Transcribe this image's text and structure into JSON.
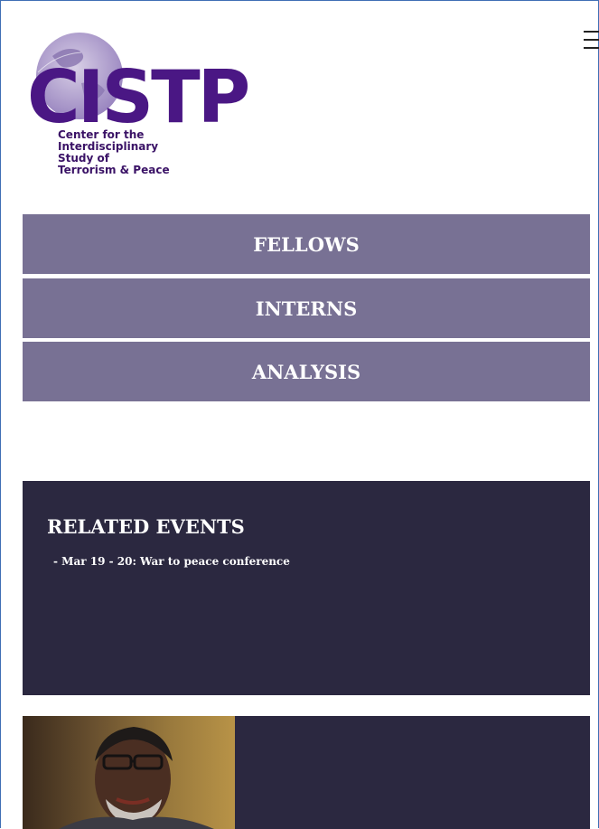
{
  "header": {
    "logo": {
      "wordmark": "CISTP",
      "tagline": [
        "Center for the",
        "Interdisciplinary",
        "Study of",
        "Terrorism & Peace"
      ]
    },
    "menu_icon": "hamburger-icon"
  },
  "nav": {
    "items": [
      {
        "label": "FELLOWS"
      },
      {
        "label": "INTERNS"
      },
      {
        "label": "ANALYSIS"
      }
    ]
  },
  "events": {
    "title": "RELATED EVENTS",
    "items": [
      "- Mar 19 - 20: War to peace conference"
    ]
  },
  "colors": {
    "nav_bg": "#787194",
    "dark_panel": "#2b2840",
    "logo_purple": "#4a1784"
  }
}
